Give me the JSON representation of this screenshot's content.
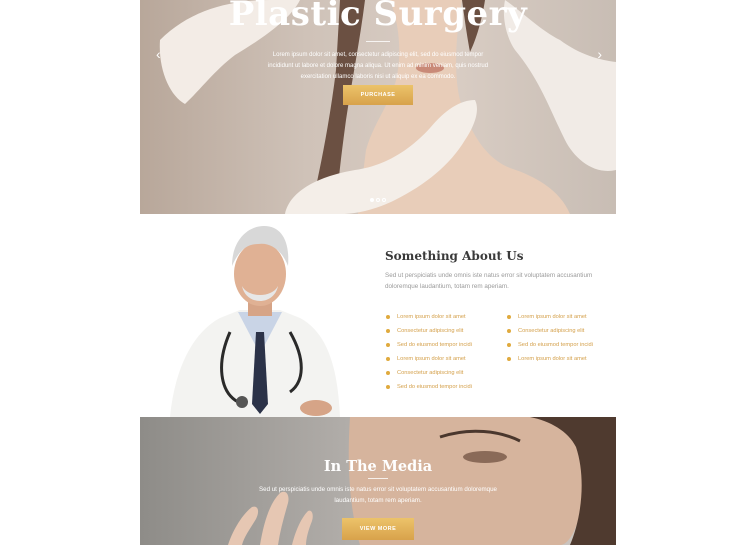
{
  "hero": {
    "title": "Plastic Surgery",
    "text": "Lorem ipsum dolor sit amet, consectetur adipiscing elit, sed do eiusmod tempor incididunt ut labore et dolore magna aliqua. Ut enim ad minim veniam, quis nostrud exercitation ullamco laboris nisi ut aliquip ex ea commodo.",
    "button_label": "PURCHASE",
    "prev_arrow": "‹",
    "next_arrow": "›",
    "slide_count": 3,
    "active_slide": 1
  },
  "about": {
    "heading": "Something About Us",
    "text": "Sed ut perspiciatis unde omnis iste natus error sit voluptatem accusantium doloremque laudantium, totam rem aperiam.",
    "list_left": [
      "Lorem ipsum dolor sit amet",
      "Consectetur adipiscing elit",
      "Sed do eiusmod tempor incidi",
      "Lorem ipsum dolor sit amet",
      "Consectetur adipiscing elit",
      "Sed do eiusmod tempor incidi"
    ],
    "list_right": [
      "Lorem ipsum dolor sit amet",
      "Consectetur adipiscing elit",
      "Sed do eiusmod tempor incidi",
      "Lorem ipsum dolor sit amet"
    ]
  },
  "media": {
    "title": "In The Media",
    "text": "Sed ut perspiciatis unde omnis iste natus error sit voluptatem accusantium doloremque laudantium, totam rem aperiam.",
    "button_label": "VIEW MORE"
  },
  "colors": {
    "accent": "#e0aa3e",
    "heading": "#3a3a3a",
    "body_text": "#9a9a9a"
  }
}
